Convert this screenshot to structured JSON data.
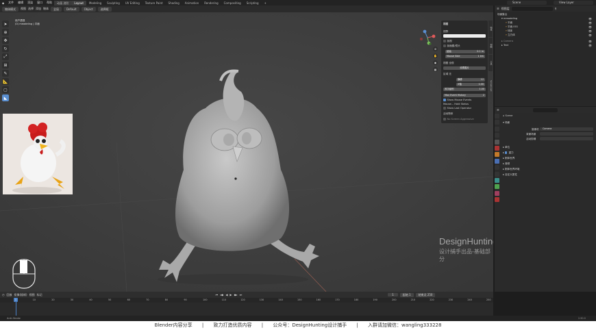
{
  "topbar": {
    "menus": [
      "文件",
      "编辑",
      "渲染",
      "窗口",
      "帮助"
    ],
    "current_tab": "动画 进阶",
    "workspaces": [
      "Layout",
      "Modeling",
      "Sculpting",
      "UV Editing",
      "Texture Paint",
      "Shading",
      "Animation",
      "Rendering",
      "Compositing",
      "Scripting"
    ],
    "scene_name": "Scene",
    "view_layer": "View Layer"
  },
  "viewport_header": {
    "mode": "物体模式",
    "menus": [
      "视图",
      "选择",
      "添加",
      "物体"
    ],
    "transform": "全局",
    "orientation": "Default",
    "object": "Object",
    "drag": "选择框"
  },
  "viewport_info": {
    "line1": "用户透视",
    "line2": "(0) meadeling | 平面"
  },
  "npanel": {
    "tab": "视图",
    "label_bg": "视野",
    "checkbox_1": "剖视",
    "checkbox_2": "剖面图/镜头",
    "clip_start_label": "起始",
    "clip_start_value": "0.1 m",
    "clip_end_label": "Mouse Side",
    "clip_end_value": "1 km",
    "local_label": "视图",
    "local_value": "全视",
    "reset_label": "设置图片",
    "cursor_label": "区域",
    "cursor_value": "无",
    "field_1_label": "横移",
    "field_1_value": "12",
    "field_2_label": "X轴",
    "field_2_value": "1.00",
    "field_3_label": "其次级别",
    "field_3_value": "1.00",
    "max_history_label": "Max Event History",
    "max_history_value": "2",
    "show_mouse_events": "Show Mouse Events",
    "mouse_hold_label": "Mouse...",
    "mouse_hold_value": "Hold Status",
    "show_last_operator": "Show Last Operator",
    "section_2": "活动物体",
    "no_screen": "No Screen Aggressive",
    "side_tabs": [
      "物体",
      "视图",
      "工具",
      "Screencast"
    ]
  },
  "outliner": {
    "search_placeholder": "",
    "display_mode": "视图层",
    "rows": [
      {
        "label": "场景集合",
        "indent": 0
      },
      {
        "label": "mmodeling",
        "indent": 1
      },
      {
        "label": "平面",
        "indent": 2
      },
      {
        "label": "平面.001",
        "indent": 2
      },
      {
        "label": "球体",
        "indent": 2
      },
      {
        "label": "立方体",
        "indent": 2
      },
      {
        "label": "Camera",
        "indent": 1
      },
      {
        "label": "Text",
        "indent": 1
      }
    ]
  },
  "properties": {
    "scene_title": "Scene",
    "section_scene": "场景",
    "camera_label": "摄像机",
    "camera_value": "Camera",
    "bg_scene_label": "背景场景",
    "active_clip_label": "活动剪辑",
    "sections": [
      "单位",
      "重力",
      "刚体世界",
      "音频",
      "刚体世界环境",
      "自定义属性"
    ],
    "gravity_checkbox": "重力"
  },
  "timeline": {
    "menus": [
      "回放",
      "抠像(插帧)",
      "视图",
      "标记"
    ],
    "current_frame": "1",
    "start_label": "起始",
    "start_value": "1",
    "end_label": "结束点",
    "end_value": "250",
    "ticks": [
      "0",
      "10",
      "20",
      "30",
      "40",
      "50",
      "60",
      "70",
      "80",
      "90",
      "100",
      "110",
      "120",
      "130",
      "140",
      "150",
      "160",
      "170",
      "180",
      "190",
      "200",
      "210",
      "220",
      "230",
      "240",
      "250"
    ]
  },
  "statusbar": {
    "left_text": "Anti-Stroke",
    "version": "2.90.0"
  },
  "watermark": {
    "line1": "DesignHunting",
    "line2": "设计捕手出品-基础部分"
  },
  "caption": {
    "part1": "Blender内容分享",
    "sep": "|",
    "part2": "致力打造优质内容",
    "part3": "公众号：DesignHunting设计捕手",
    "part4": "入群请加微信：wangling333228"
  },
  "colors": {
    "accent": "#5a8fd1",
    "viewport_bg": "#3f3f3f",
    "panel_bg": "#2a2a2a"
  }
}
